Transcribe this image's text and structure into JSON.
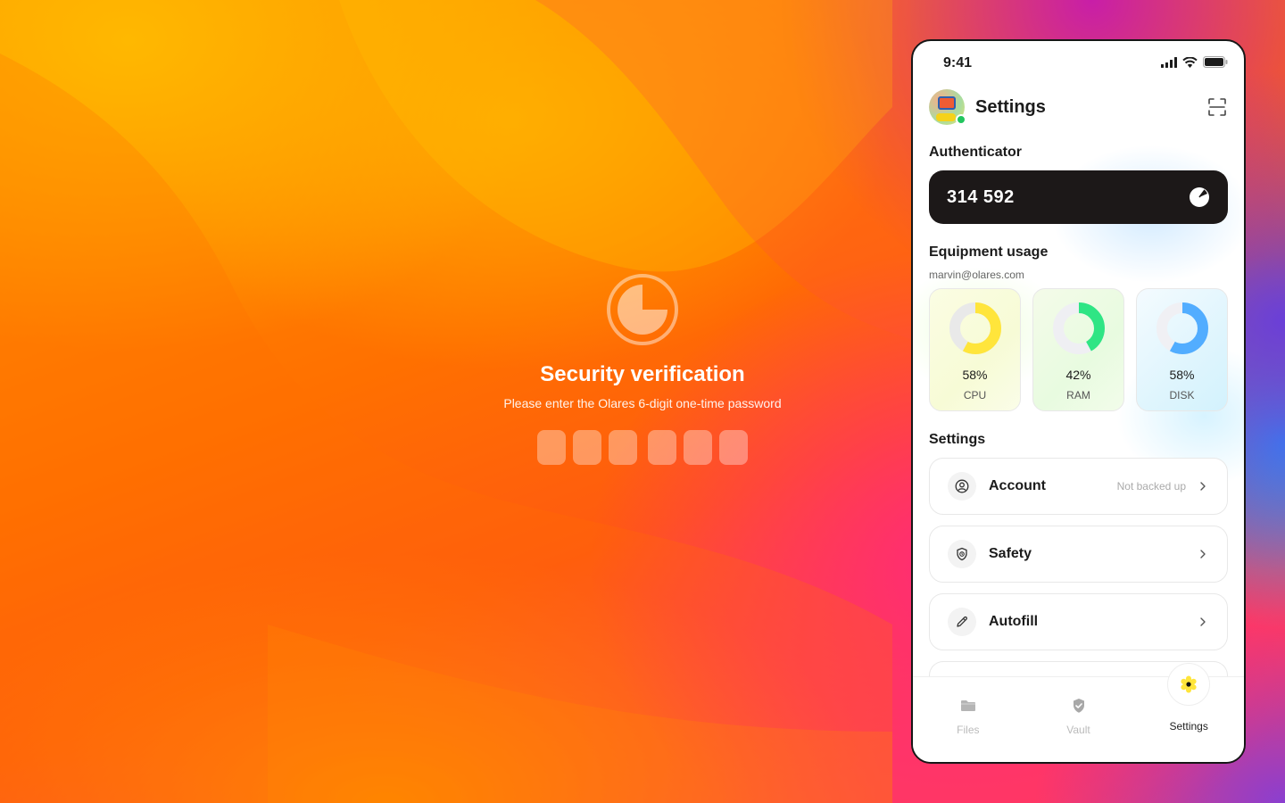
{
  "verification": {
    "title": "Security verification",
    "subtitle": "Please enter the Olares 6-digit one-time password",
    "otp_length": 6,
    "icon": "timer-pie-icon"
  },
  "phone": {
    "status_bar": {
      "time": "9:41",
      "icons": [
        "signal-icon",
        "wifi-icon",
        "battery-icon"
      ]
    },
    "header": {
      "title": "Settings",
      "avatar_online": true,
      "scan_icon": "scan-icon"
    },
    "authenticator": {
      "label": "Authenticator",
      "code": "314 592",
      "timer_icon": "timer-pie-icon"
    },
    "equipment": {
      "label": "Equipment usage",
      "email": "marvin@olares.com",
      "items": [
        {
          "name": "CPU",
          "percent": 58,
          "percent_label": "58%",
          "color": "#FFE53B",
          "track": "#E9E9E9"
        },
        {
          "name": "RAM",
          "percent": 42,
          "percent_label": "42%",
          "color": "#2FE584",
          "track": "#EFEFF3"
        },
        {
          "name": "DISK",
          "percent": 58,
          "percent_label": "58%",
          "color": "#52ADFF",
          "track": "#F0F0F4"
        }
      ]
    },
    "settings": {
      "label": "Settings",
      "items": [
        {
          "label": "Account",
          "status": "Not backed up",
          "icon": "user-circle-icon"
        },
        {
          "label": "Safety",
          "status": "",
          "icon": "shield-icon"
        },
        {
          "label": "Autofill",
          "status": "",
          "icon": "pen-icon"
        }
      ]
    },
    "tabbar": {
      "tabs": [
        {
          "label": "Files",
          "icon": "folder-icon",
          "active": false
        },
        {
          "label": "Vault",
          "icon": "shield-check-icon",
          "active": false
        },
        {
          "label": "Settings",
          "icon": "gear-icon",
          "active": true
        }
      ],
      "accent": "#FFE53B"
    }
  }
}
